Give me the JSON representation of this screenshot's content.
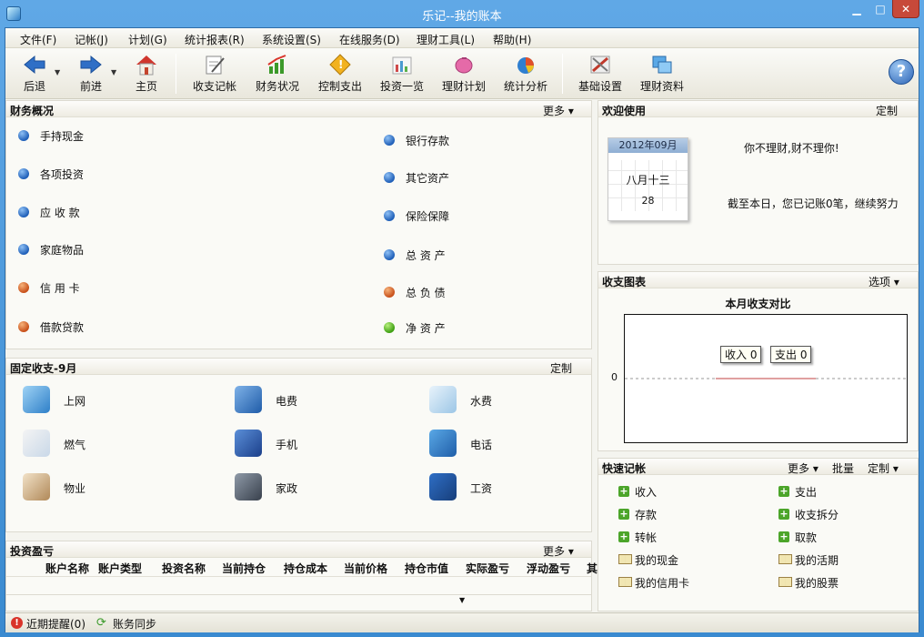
{
  "window": {
    "title": "乐记--我的账本",
    "min": "▁",
    "max": "□",
    "close": "✕"
  },
  "menu": [
    {
      "label": "文件(F)"
    },
    {
      "label": "记帐(J)"
    },
    {
      "label": "计划(G)"
    },
    {
      "label": "统计报表(R)"
    },
    {
      "label": "系统设置(S)"
    },
    {
      "label": "在线服务(D)"
    },
    {
      "label": "理财工具(L)"
    },
    {
      "label": "帮助(H)"
    }
  ],
  "toolbar": {
    "back": "后退",
    "forward": "前进",
    "home": "主页",
    "income_expense": "收支记帐",
    "finance_status": "财务状况",
    "control_spend": "控制支出",
    "invest_list": "投资一览",
    "finance_plan": "理财计划",
    "stat_analysis": "统计分析",
    "basic_settings": "基础设置",
    "finance_data": "理财资料",
    "help": "?"
  },
  "overview": {
    "title": "财务概况",
    "more": "更多",
    "left": [
      {
        "label": "手持现金",
        "color": "blue"
      },
      {
        "label": "各项投资",
        "color": "blue"
      },
      {
        "label": "应 收 款",
        "color": "blue"
      },
      {
        "label": "家庭物品",
        "color": "blue"
      },
      {
        "label": "信 用 卡",
        "color": "orange"
      },
      {
        "label": "借款贷款",
        "color": "orange"
      }
    ],
    "right": [
      {
        "label": "银行存款",
        "color": "blue"
      },
      {
        "label": "其它资产",
        "color": "blue"
      },
      {
        "label": "保险保障",
        "color": "blue"
      },
      {
        "label": "总 资 产",
        "color": "blue"
      },
      {
        "label": "总 负 债",
        "color": "orange"
      },
      {
        "label": "净 资 产",
        "color": "green"
      }
    ]
  },
  "fixed": {
    "title": "固定收支-9月",
    "custom": "定制",
    "items": [
      "上网",
      "电费",
      "水费",
      "燃气",
      "手机",
      "电话",
      "物业",
      "家政",
      "工资"
    ]
  },
  "invest": {
    "title": "投资盈亏",
    "more": "更多",
    "columns": [
      "账户名称",
      "账户类型",
      "投资名称",
      "当前持仓",
      "持仓成本",
      "当前价格",
      "持仓市值",
      "实际盈亏",
      "浮动盈亏",
      "其"
    ]
  },
  "welcome": {
    "title": "欢迎使用",
    "custom": "定制",
    "cal_month": "2012年09月",
    "cal_lunar": "八月十三",
    "cal_day": "28",
    "slogan": "你不理财,财不理你!",
    "note": "截至本日，您已记账0笔，继续努力"
  },
  "chart_panel": {
    "title": "收支图表",
    "options": "选项"
  },
  "chart_data": {
    "type": "bar",
    "title": "本月收支对比",
    "categories": [
      "收入",
      "支出"
    ],
    "series": [
      {
        "name": "收入",
        "values": [
          0
        ]
      },
      {
        "name": "支出",
        "values": [
          0
        ]
      }
    ],
    "legend": [
      "收入 0",
      "支出 0"
    ],
    "y_ticks": [
      "0"
    ],
    "legend_placement": "top-center"
  },
  "quick": {
    "title": "快速记帐",
    "more": "更多",
    "batch": "批量",
    "custom": "定制",
    "left": [
      {
        "label": "收入",
        "icon": "plus"
      },
      {
        "label": "存款",
        "icon": "plus"
      },
      {
        "label": "转帐",
        "icon": "plus"
      },
      {
        "label": "我的现金",
        "icon": "book"
      },
      {
        "label": "我的信用卡",
        "icon": "book"
      }
    ],
    "right": [
      {
        "label": "支出",
        "icon": "plus"
      },
      {
        "label": "收支拆分",
        "icon": "plus"
      },
      {
        "label": "取款",
        "icon": "plus"
      },
      {
        "label": "我的活期",
        "icon": "book"
      },
      {
        "label": "我的股票",
        "icon": "book"
      }
    ]
  },
  "status": {
    "reminder": "近期提醒(0)",
    "sync": "账务同步"
  }
}
